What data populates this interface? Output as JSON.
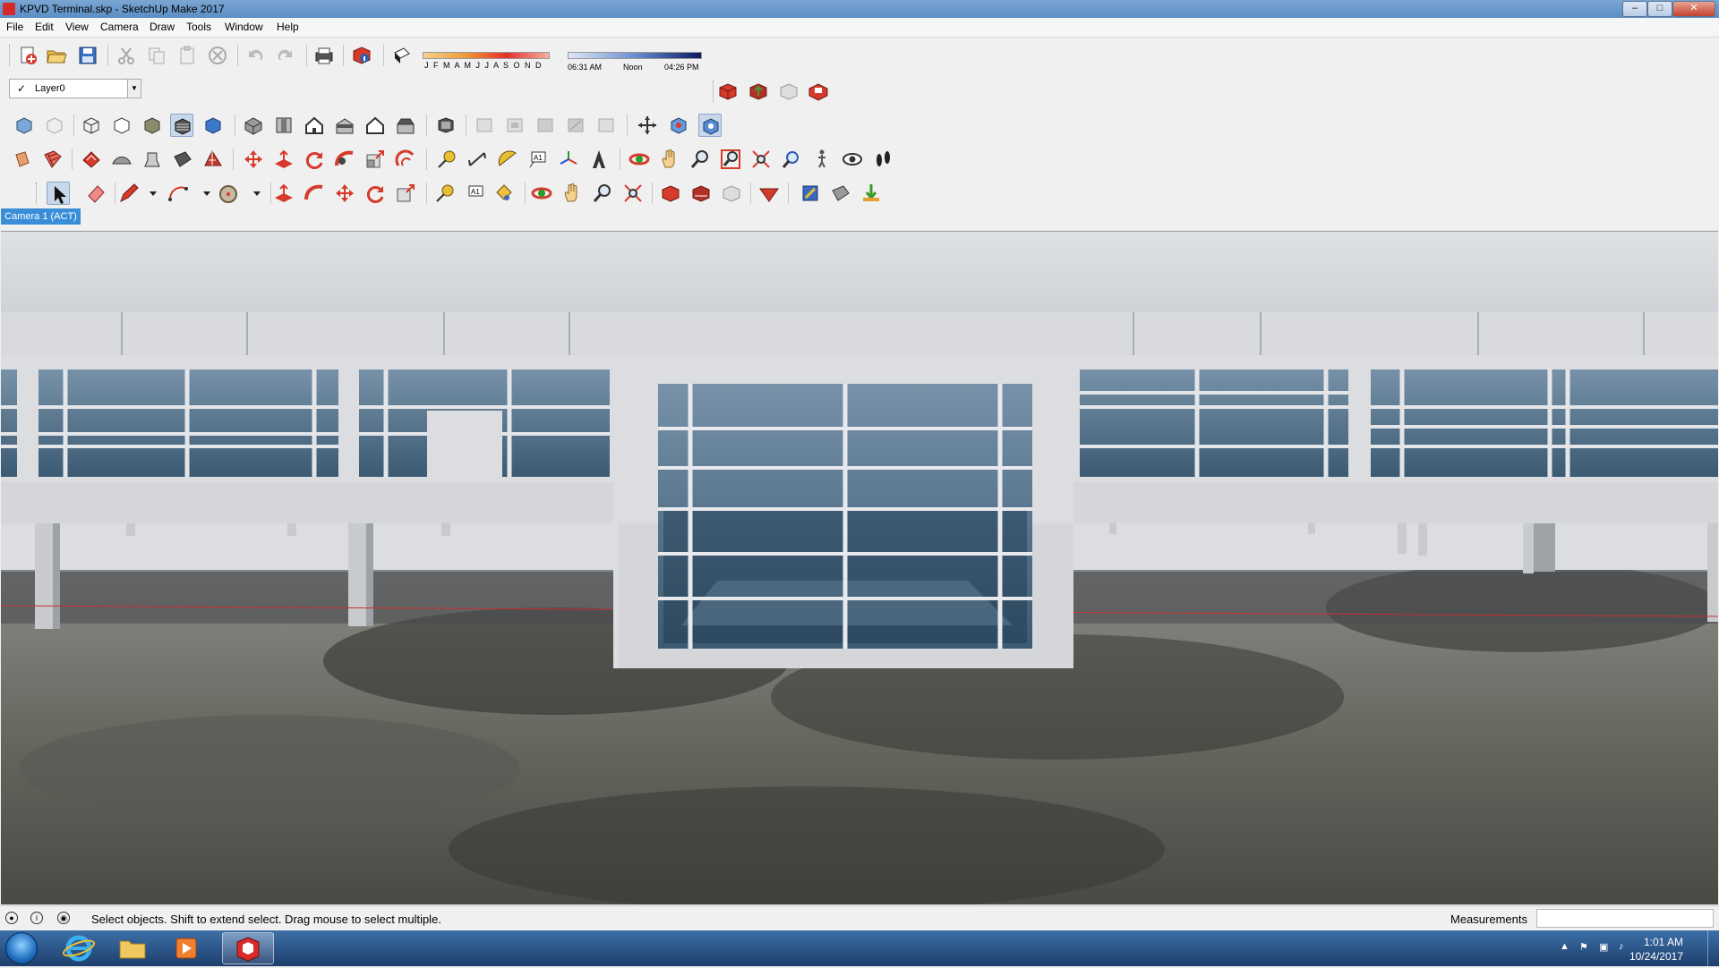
{
  "window": {
    "title": "KPVD Terminal.skp - SketchUp Make 2017",
    "controls": [
      "minimize",
      "maximize",
      "close"
    ]
  },
  "menu": [
    "File",
    "Edit",
    "View",
    "Camera",
    "Draw",
    "Tools",
    "Window",
    "Help"
  ],
  "shadows": {
    "months": "J F M A M J J A S O N D",
    "time_start": "06:31 AM",
    "time_mid": "Noon",
    "time_end": "04:26 PM"
  },
  "layer": {
    "check": "✓",
    "current": "Layer0"
  },
  "scene_tab": "Camera 1 (ACT)",
  "status": {
    "message": "Select objects. Shift to extend select. Drag mouse to select multiple.",
    "measurements_label": "Measurements",
    "measurements_value": ""
  },
  "taskbar": {
    "apps": [
      "internet-explorer",
      "file-explorer",
      "media-player",
      "sketchup"
    ],
    "time": "1:01 AM",
    "date": "10/24/2017"
  },
  "colors": {
    "sky": "#d9dcdf",
    "wall": "#dcdde0",
    "glass": "#3f5e78",
    "ground": "#6e6d68",
    "axis_red": "#c83030",
    "scene_tab": "#3a8ed8"
  }
}
